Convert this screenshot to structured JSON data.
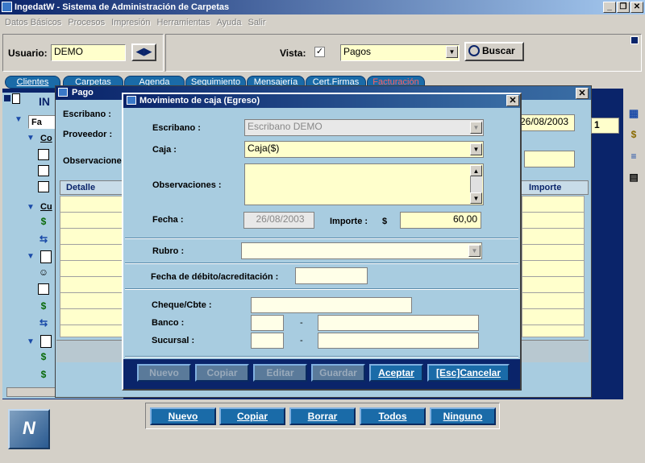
{
  "app": {
    "title": "IngedatW - Sistema de Administración de Carpetas"
  },
  "menu": [
    "Datos Básicos",
    "Procesos",
    "Impresión",
    "Herramientas",
    "Ayuda",
    "Salir"
  ],
  "toolbar": {
    "user_label": "Usuario:",
    "user_value": "DEMO",
    "view_label": "Vista:",
    "view_value": "Pagos",
    "search_label": "Buscar"
  },
  "tabs": [
    "Clientes",
    "Carpetas",
    "Agenda",
    "Seguimiento",
    "Mensajería",
    "Cert.Firmas",
    "Facturación"
  ],
  "pago": {
    "title": "Pago",
    "escribano_label": "Escribano :",
    "proveedor_label": "Proveedor :",
    "observaciones_label": "Observacione",
    "date": "26/08/2003",
    "detalle_header": "Detalle",
    "importe_header": "Importe",
    "side_value": "1"
  },
  "tree": {
    "fa": "Fa",
    "co": "Co",
    "cu": "Cu"
  },
  "dialog": {
    "title": "Movimiento de caja (Egreso)",
    "escribano_label": "Escribano :",
    "escribano_value": "Escribano DEMO",
    "caja_label": "Caja :",
    "caja_value": "Caja($)",
    "obs_label": "Observaciones :",
    "fecha_label": "Fecha :",
    "fecha_value": "26/08/2003",
    "importe_label": "Importe :",
    "currency": "$",
    "importe_value": "60,00",
    "rubro_label": "Rubro :",
    "fecha_debito_label": "Fecha de débito/acreditación :",
    "cheque_label": "Cheque/Cbte :",
    "banco_label": "Banco :",
    "sucursal_label": "Sucursal :",
    "dash": "-",
    "buttons": {
      "nuevo": "Nuevo",
      "copiar": "Copiar",
      "editar": "Editar",
      "guardar": "Guardar",
      "aceptar": "Aceptar",
      "cancelar": "[Esc]Cancelar"
    }
  },
  "bottom": {
    "nuevo": "Nuevo",
    "copiar": "Copiar",
    "borrar": "Borrar",
    "todos": "Todos",
    "ninguno": "Ninguno"
  }
}
